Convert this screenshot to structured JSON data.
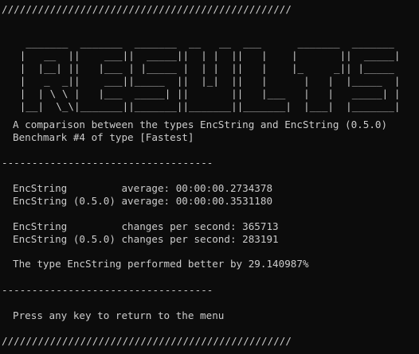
{
  "console": {
    "border_top": "////////////////////////////////////////////////",
    "banner_art": "\n    _______  _______  _______  __   __  ___      _______  _______ \n   |   __  ||    ___||  _____||  | |  ||   |    |       ||  _____|\n   |  |__| ||   |___ | |_____ |  | |  ||   |    |_     _|| |_____ \n   |   _  _||    ___||_____  ||  |_|  ||   |      |   |  |_____  |\n   |  | \\ \\ |   |___  _____| ||       ||   |___   |   |   _____| |\n   |__|  \\_\\|_______||_______||_______||_______|  |___|  |_______|",
    "comparison_line": "A comparison between the types EncString and EncString (0.5.0)",
    "benchmark_line": "Benchmark #4 of type [Fastest]",
    "separator": "-----------------------------------",
    "average_line_1": "EncString         average: 00:00:00.2734378",
    "average_line_2": "EncString (0.5.0) average: 00:00:00.3531180",
    "changes_line_1": "EncString         changes per second: 365713",
    "changes_line_2": "EncString (0.5.0) changes per second: 283191",
    "result_line": "The type EncString performed better by 29.140987%",
    "prompt_line": "Press any key to return to the menu",
    "border_bottom": "////////////////////////////////////////////////"
  }
}
